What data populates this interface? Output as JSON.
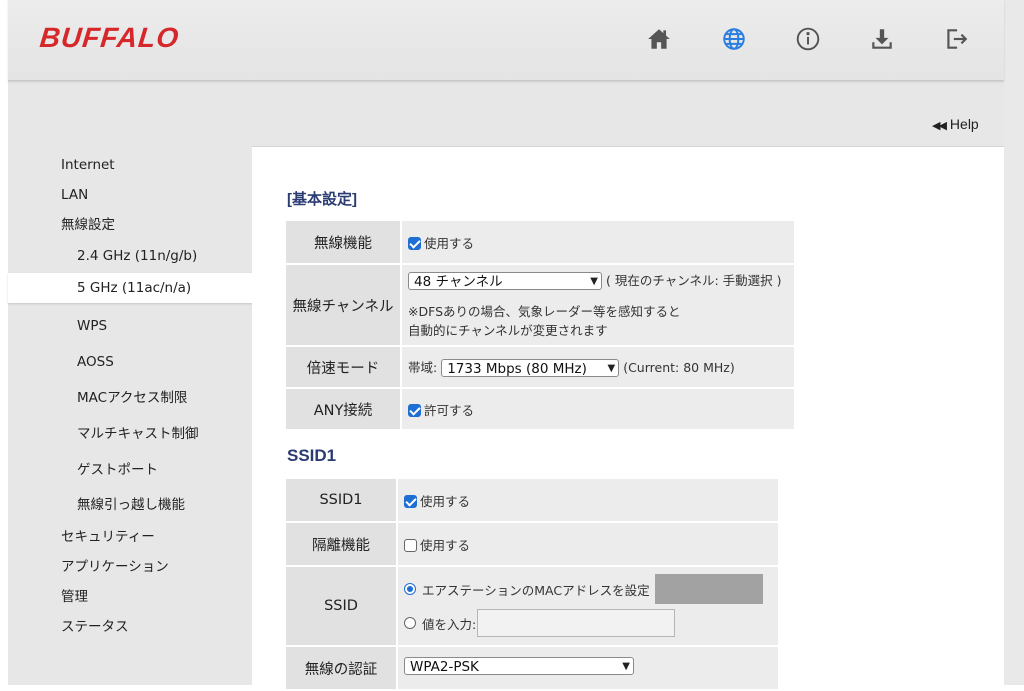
{
  "header": {
    "logo": "BUFFALO",
    "icons": [
      "home-icon",
      "globe-icon",
      "info-icon",
      "download-icon",
      "logout-icon"
    ]
  },
  "help_label": "Help",
  "sidebar": {
    "items": [
      {
        "label": "Internet",
        "level": "top"
      },
      {
        "label": "LAN",
        "level": "top"
      },
      {
        "label": "無線設定",
        "level": "top"
      },
      {
        "label": "2.4 GHz (11n/g/b)",
        "level": "sub"
      },
      {
        "label": "5 GHz (11ac/n/a)",
        "level": "sub",
        "active": true
      },
      {
        "label": "WPS",
        "level": "sub"
      },
      {
        "label": "AOSS",
        "level": "sub"
      },
      {
        "label": "MACアクセス制限",
        "level": "sub"
      },
      {
        "label": "マルチキャスト制御",
        "level": "sub"
      },
      {
        "label": "ゲストポート",
        "level": "sub"
      },
      {
        "label": "無線引っ越し機能",
        "level": "sub"
      },
      {
        "label": "セキュリティー",
        "level": "top"
      },
      {
        "label": "アプリケーション",
        "level": "top"
      },
      {
        "label": "管理",
        "level": "top"
      },
      {
        "label": "ステータス",
        "level": "top"
      }
    ]
  },
  "basic": {
    "title": "[基本設定]",
    "wireless_label": "無線機能",
    "wireless_check": "使用する",
    "channel_label": "無線チャンネル",
    "channel_value": "48 チャンネル",
    "channel_current": "( 現在のチャンネル:  手動選択 )",
    "channel_note1": "※DFSありの場合、気象レーダー等を感知すると",
    "channel_note2": "自動的にチャンネルが変更されます",
    "speed_label": "倍速モード",
    "band_label": "帯域:",
    "band_value": "1733 Mbps (80 MHz)",
    "band_current": "(Current: 80 MHz)",
    "any_label": "ANY接続",
    "any_check": "許可する"
  },
  "ssid1": {
    "title": "SSID1",
    "ssid1_label": "SSID1",
    "ssid1_check": "使用する",
    "isolation_label": "隔離機能",
    "isolation_check": "使用する",
    "ssid_label": "SSID",
    "option_mac": "エアステーションのMACアドレスを設定",
    "option_input": "値を入力:",
    "auth_label": "無線の認証",
    "auth_value": "WPA2-PSK"
  },
  "colors": {
    "brand_red": "#d6282a",
    "accent_blue": "#1f6ed4",
    "title_navy": "#2b3c73"
  }
}
